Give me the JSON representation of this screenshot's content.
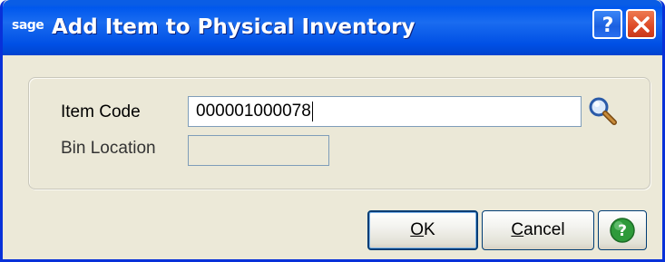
{
  "window": {
    "app_logo": "sage",
    "title": "Add Item to Physical Inventory"
  },
  "titlebar_buttons": {
    "help_icon": "question-mark-icon",
    "close_icon": "close-x-icon"
  },
  "form": {
    "item_code_label": "Item Code",
    "item_code_value": "000001000078",
    "bin_location_label": "Bin Location",
    "bin_location_value": "",
    "lookup_icon": "magnifier-icon"
  },
  "buttons": {
    "ok_label_underlined": "O",
    "ok_label_rest": "K",
    "cancel_label_underlined": "C",
    "cancel_label_rest": "ancel",
    "help_icon": "green-help-icon"
  },
  "colors": {
    "titlebar": "#0058ee",
    "dialog_bg": "#ece9d8",
    "close_button": "#dd4a26",
    "help_green": "#2e9a3a"
  }
}
